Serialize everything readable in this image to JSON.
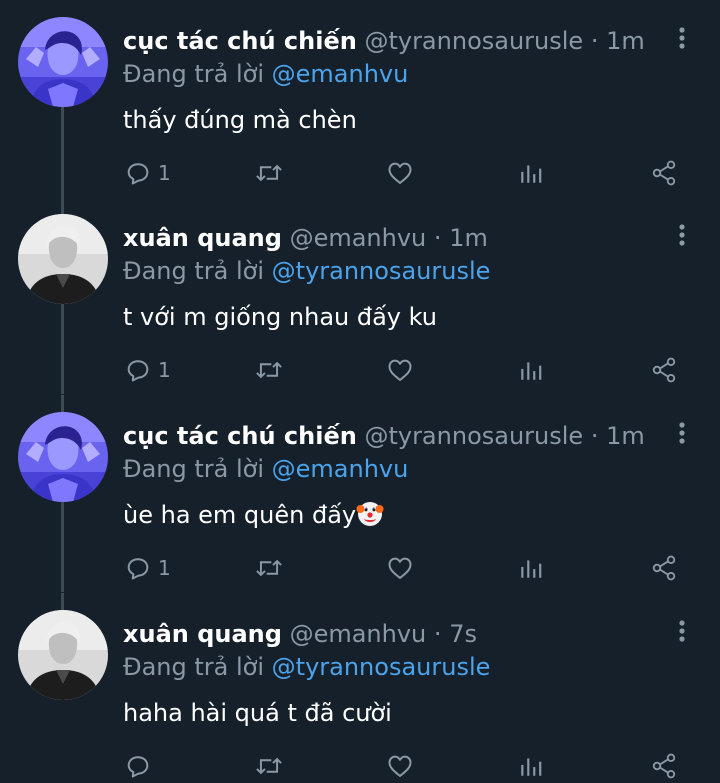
{
  "tweets": [
    {
      "display_name": "cục tác chú chiến",
      "handle": "@tyrannosaurusle",
      "separator": "·",
      "time": "1m",
      "replying_prefix": "Đang trả lời",
      "replying_to": "@emanhvu",
      "text": "thấy đúng mà chèn",
      "reply_count": "1",
      "avatar": "blue-portrait"
    },
    {
      "display_name": "xuân quang",
      "handle": "@emanhvu",
      "separator": "·",
      "time": "1m",
      "replying_prefix": "Đang trả lời",
      "replying_to": "@tyrannosaurusle",
      "text": "t với m giống nhau đấy ku",
      "reply_count": "1",
      "avatar": "bw-portrait"
    },
    {
      "display_name": "cục tác chú chiến",
      "handle": "@tyrannosaurusle",
      "separator": "·",
      "time": "1m",
      "replying_prefix": "Đang trả lời",
      "replying_to": "@emanhvu",
      "text": "ùe ha em quên đấy",
      "emoji": "clown-face",
      "reply_count": "1",
      "avatar": "blue-portrait"
    },
    {
      "display_name": "xuân quang",
      "handle": "@emanhvu",
      "separator": "·",
      "time": "7s",
      "replying_prefix": "Đang trả lời",
      "replying_to": "@tyrannosaurusle",
      "text": "haha hài quá t đã cười",
      "reply_count": "",
      "avatar": "bw-portrait"
    }
  ],
  "icons": {
    "reply": "reply-icon",
    "retweet": "retweet-icon",
    "like": "heart-icon",
    "analytics": "analytics-icon",
    "share": "share-icon",
    "more": "more-vertical-icon"
  },
  "colors": {
    "background": "#15202b",
    "primary_text": "#ffffff",
    "secondary_text": "#8b98a5",
    "mention": "#4ba3eb",
    "thread_line": "#3d4a57",
    "avatar_blue": "#5b54e8"
  }
}
